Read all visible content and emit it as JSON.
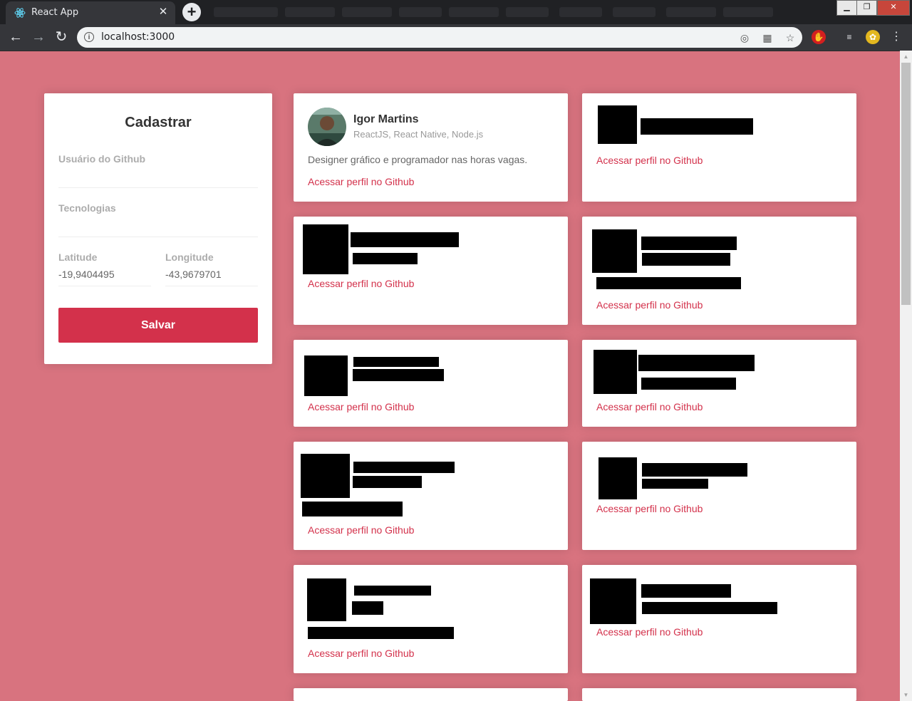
{
  "browser": {
    "tab_title": "React App",
    "url": "localhost:3000"
  },
  "form": {
    "title": "Cadastrar",
    "github_label": "Usuário do Github",
    "techs_label": "Tecnologias",
    "latitude_label": "Latitude",
    "latitude_value": "-19,9404495",
    "longitude_label": "Longitude",
    "longitude_value": "-43,9679701",
    "save_label": "Salvar"
  },
  "devs": [
    {
      "name": "Igor Martins",
      "techs": "ReactJS, React Native, Node.js",
      "bio": "Designer gráfico e programador nas horas vagas.",
      "link": "Acessar perfil no Github"
    },
    {
      "link": "Acessar perfil no Github"
    },
    {
      "link": "Acessar perfil no Github"
    },
    {
      "link": "Acessar perfil no Github"
    },
    {
      "link": "Acessar perfil no Github"
    },
    {
      "link": "Acessar perfil no Github"
    },
    {
      "link": "Acessar perfil no Github"
    },
    {
      "link": "Acessar perfil no Github"
    },
    {
      "link": "Acessar perfil no Github"
    },
    {
      "link": "Acessar perfil no Github"
    }
  ]
}
